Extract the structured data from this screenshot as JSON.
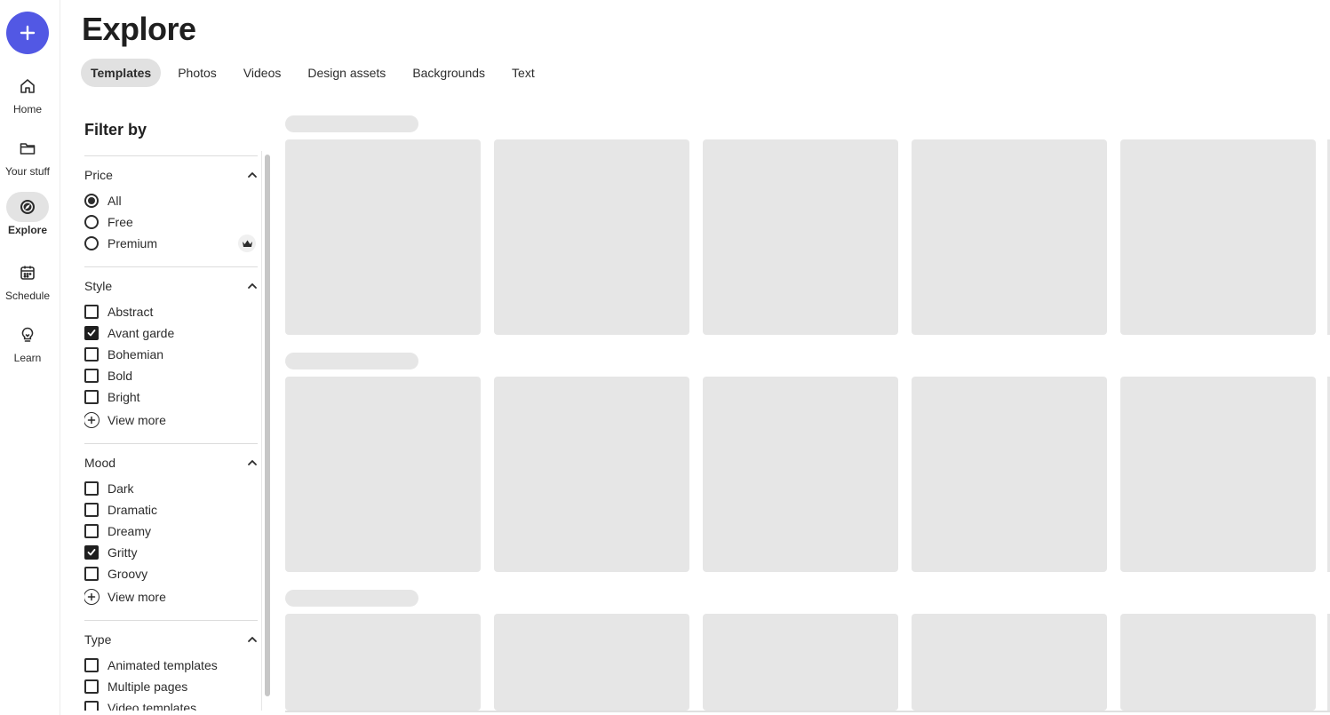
{
  "rail": {
    "create_label": "+",
    "items": [
      {
        "label": "Home",
        "icon": "home-icon",
        "active": false
      },
      {
        "label": "Your stuff",
        "icon": "folder-icon",
        "active": false
      },
      {
        "label": "Explore",
        "icon": "compass-icon",
        "active": true
      },
      {
        "label": "Schedule",
        "icon": "calendar-icon",
        "active": false
      },
      {
        "label": "Learn",
        "icon": "lightbulb-icon",
        "active": false
      }
    ]
  },
  "header": {
    "title": "Explore",
    "tabs": [
      {
        "label": "Templates",
        "active": true
      },
      {
        "label": "Photos",
        "active": false
      },
      {
        "label": "Videos",
        "active": false
      },
      {
        "label": "Design assets",
        "active": false
      },
      {
        "label": "Backgrounds",
        "active": false
      },
      {
        "label": "Text",
        "active": false
      }
    ]
  },
  "filters": {
    "title": "Filter by",
    "price": {
      "label": "Price",
      "options": [
        {
          "label": "All",
          "selected": true
        },
        {
          "label": "Free",
          "selected": false
        },
        {
          "label": "Premium",
          "selected": false
        }
      ]
    },
    "style": {
      "label": "Style",
      "options": [
        {
          "label": "Abstract",
          "checked": false
        },
        {
          "label": "Avant garde",
          "checked": true
        },
        {
          "label": "Bohemian",
          "checked": false
        },
        {
          "label": "Bold",
          "checked": false
        },
        {
          "label": "Bright",
          "checked": false
        }
      ],
      "view_more": "View more"
    },
    "mood": {
      "label": "Mood",
      "options": [
        {
          "label": "Dark",
          "checked": false
        },
        {
          "label": "Dramatic",
          "checked": false
        },
        {
          "label": "Dreamy",
          "checked": false
        },
        {
          "label": "Gritty",
          "checked": true
        },
        {
          "label": "Groovy",
          "checked": false
        }
      ],
      "view_more": "View more"
    },
    "type": {
      "label": "Type",
      "options": [
        {
          "label": "Animated templates",
          "checked": false
        },
        {
          "label": "Multiple pages",
          "checked": false
        },
        {
          "label": "Video templates",
          "checked": false
        }
      ]
    }
  },
  "colors": {
    "accent": "#5258e4",
    "skeleton": "#e6e6e6",
    "active_tab_bg": "#e1e1e1"
  }
}
